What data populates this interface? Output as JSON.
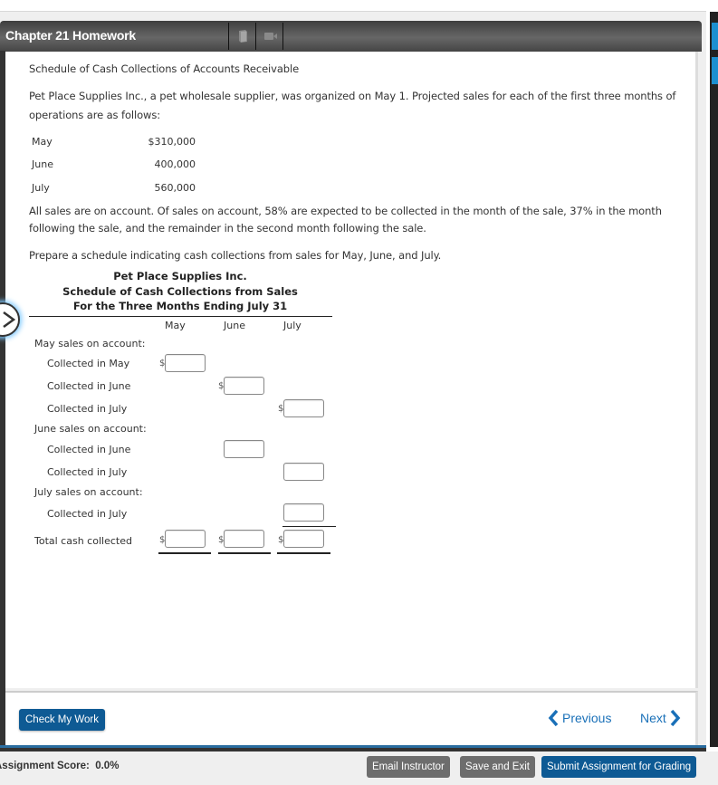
{
  "window": {
    "title": "Chapter 21 Homework",
    "toolbar_icons": [
      "book-icon",
      "video-icon"
    ]
  },
  "problem": {
    "heading": "Schedule of Cash Collections of Accounts Receivable",
    "intro_line1": "Pet Place Supplies Inc., a pet wholesale supplier, was organized on May 1. Projected sales for each of the first three months of",
    "intro_line2": "operations are as follows:",
    "sales": [
      {
        "month": "May",
        "amount": "$310,000"
      },
      {
        "month": "June",
        "amount": "400,000"
      },
      {
        "month": "July",
        "amount": "560,000"
      }
    ],
    "terms_line1": "All sales are on account. Of sales on account, 58% are expected to be collected in the month of the sale, 37% in the month",
    "terms_line2": "following the sale, and the remainder in the second month following the sale.",
    "instruction": "Prepare a schedule indicating cash collections from sales for May, June, and July."
  },
  "schedule": {
    "company": "Pet Place Supplies Inc.",
    "title": "Schedule of Cash Collections from Sales",
    "period": "For the Three Months Ending July 31",
    "columns": [
      "May",
      "June",
      "July"
    ],
    "currency_symbol": "$",
    "sections": [
      {
        "label": "May sales on account:",
        "rows": [
          {
            "label": "Collected in May",
            "may": "",
            "june": null,
            "july": null
          },
          {
            "label": "Collected in June",
            "may": null,
            "june": "",
            "july": null
          },
          {
            "label": "Collected in July",
            "may": null,
            "june": null,
            "july": ""
          }
        ]
      },
      {
        "label": "June sales on account:",
        "rows": [
          {
            "label": "Collected in June",
            "may": null,
            "june": "",
            "july": null
          },
          {
            "label": "Collected in July",
            "may": null,
            "june": null,
            "july": ""
          }
        ]
      },
      {
        "label": "July sales on account:",
        "rows": [
          {
            "label": "Collected in July",
            "may": null,
            "june": null,
            "july": ""
          }
        ]
      }
    ],
    "total_label": "Total cash collected",
    "totals": {
      "may": "",
      "june": "",
      "july": ""
    }
  },
  "footer": {
    "check_my_work": "Check My Work",
    "previous": "Previous",
    "next": "Next",
    "assignment_score_label": "Assignment Score:",
    "assignment_score_value": "0.0%",
    "email_instructor": "Email Instructor",
    "save_and_exit": "Save and Exit",
    "submit": "Submit Assignment for Grading"
  },
  "colors": {
    "primary_button": "#0e5a94",
    "secondary_button": "#6d6d6d",
    "link": "#1a70b8"
  }
}
